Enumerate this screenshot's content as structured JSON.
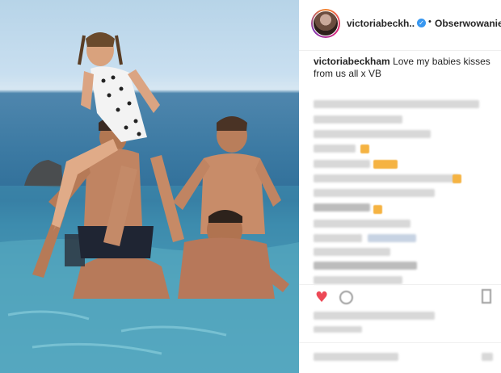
{
  "photo": {
    "description_icon": "photo-image"
  },
  "header": {
    "username": "victoriabeckh...",
    "verified_icon": "verified-badge-icon",
    "separator": "•",
    "follow_label": "Obserwowanie"
  },
  "caption": {
    "author": "victoriabeckham",
    "text": "Love my babies kisses from us all x VB"
  },
  "icons": {
    "like": "heart-icon",
    "comment": "comment-icon",
    "save": "bookmark-icon"
  },
  "colors": {
    "verified": "#3897f0",
    "heart": "#ed4956",
    "text": "#262626"
  }
}
